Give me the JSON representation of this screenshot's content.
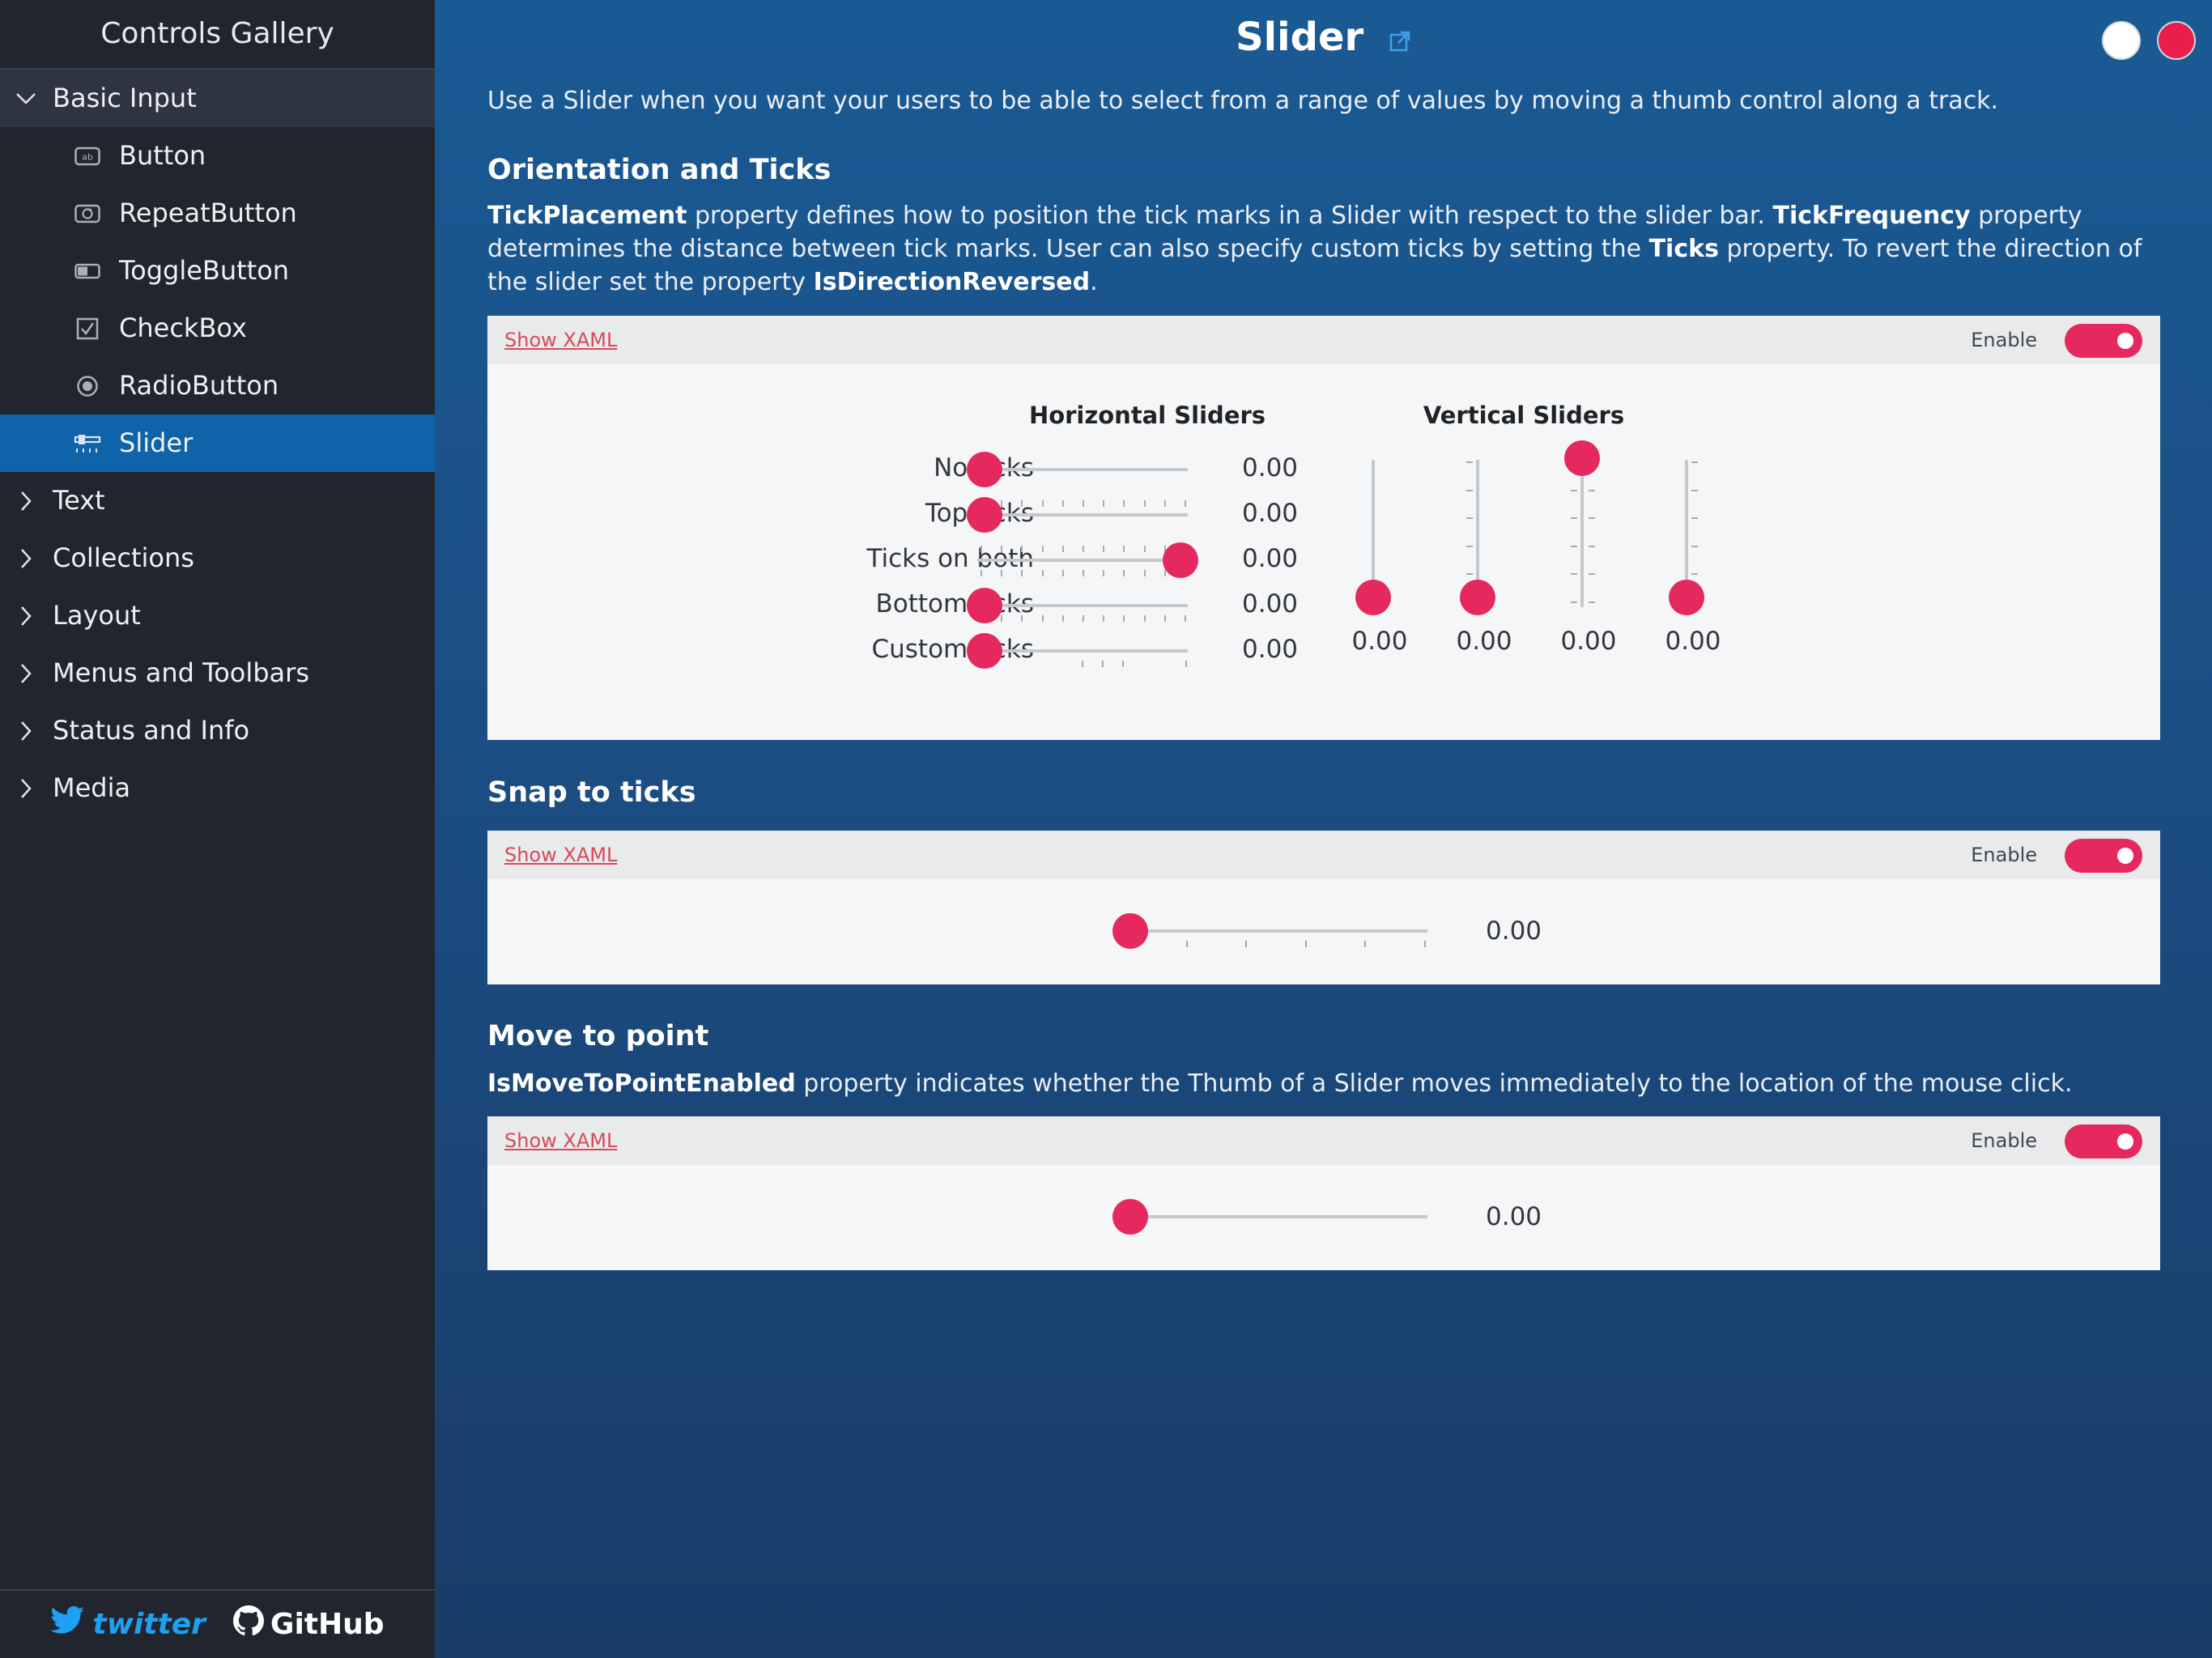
{
  "sidebar": {
    "app_title": "Controls Gallery",
    "groups": [
      {
        "label": "Basic Input",
        "expanded": true
      },
      {
        "label": "Text"
      },
      {
        "label": "Collections"
      },
      {
        "label": "Layout"
      },
      {
        "label": "Menus and Toolbars"
      },
      {
        "label": "Status and Info"
      },
      {
        "label": "Media"
      }
    ],
    "basic_input_items": [
      {
        "label": "Button",
        "icon": "button-icon"
      },
      {
        "label": "RepeatButton",
        "icon": "repeat-button-icon"
      },
      {
        "label": "ToggleButton",
        "icon": "toggle-button-icon"
      },
      {
        "label": "CheckBox",
        "icon": "checkbox-icon"
      },
      {
        "label": "RadioButton",
        "icon": "radio-button-icon"
      },
      {
        "label": "Slider",
        "icon": "slider-icon",
        "selected": true
      }
    ],
    "footer": {
      "twitter": "twitter",
      "github": "GitHub"
    }
  },
  "header": {
    "title": "Slider",
    "description": "Use a Slider when you want your users to be able to select from a range of values by moving a thumb control along a track."
  },
  "orientation": {
    "title": "Orientation and Ticks",
    "desc_parts": {
      "p1_bold": "TickPlacement",
      "p1": " property defines how to position the tick marks in a Slider with respect to the slider bar. ",
      "p2_bold": "TickFrequency",
      "p2": " property determines the distance between tick marks. User can also specify custom ticks by setting the ",
      "p3_bold": "Ticks",
      "p3": " property. To revert the direction of the slider set the property ",
      "p4_bold": "IsDirectionReversed",
      "p4": "."
    },
    "show_xaml": "Show XAML",
    "enable_label": "Enable",
    "enabled": true,
    "horizontal_heading": "Horizontal Sliders",
    "vertical_heading": "Vertical Sliders",
    "horizontal": [
      {
        "label": "No ticks",
        "value": "0.00",
        "level": 0
      },
      {
        "label": "Top ticks",
        "value": "0.00",
        "level": 0
      },
      {
        "label": "Ticks on both",
        "value": "0.00",
        "level": 1
      },
      {
        "label": "Bottom ticks",
        "value": "0.00",
        "level": 0
      },
      {
        "label": "Custom ticks",
        "value": "0.00",
        "level": 0
      }
    ],
    "vertical": [
      {
        "value": "0.00",
        "level": 0
      },
      {
        "value": "0.00",
        "level": 0
      },
      {
        "value": "0.00",
        "level": 1
      },
      {
        "value": "0.00",
        "level": 0
      }
    ]
  },
  "snap": {
    "title": "Snap to ticks",
    "show_xaml": "Show XAML",
    "enable_label": "Enable",
    "enabled": true,
    "value": "0.00",
    "level": 0
  },
  "move": {
    "title": "Move to point",
    "desc_bold": "IsMoveToPointEnabled",
    "desc": " property indicates whether the Thumb of a Slider moves immediately to the location of the mouse click.",
    "show_xaml": "Show XAML",
    "enable_label": "Enable",
    "enabled": true,
    "value": "0.00",
    "level": 0
  },
  "colors": {
    "accent": "#e5295e",
    "selected_nav": "#0f63a8",
    "sidebar_bg": "#21262e"
  }
}
